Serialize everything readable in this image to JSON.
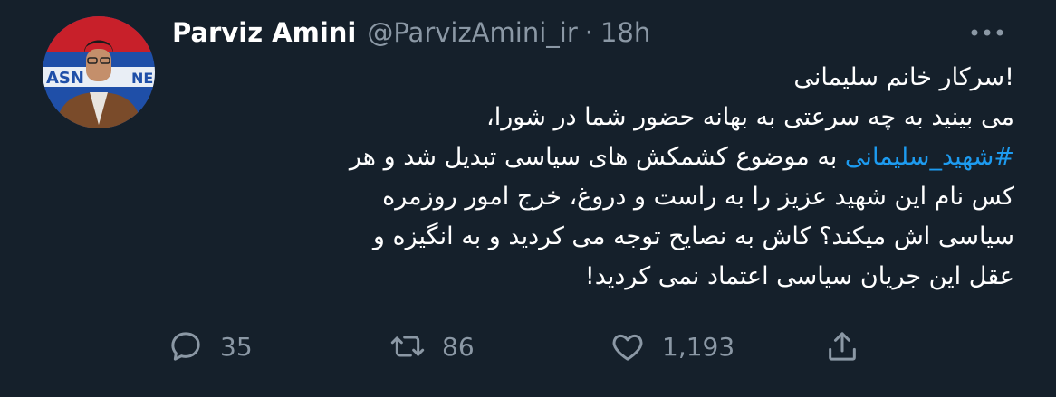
{
  "tweet": {
    "author": {
      "display_name": "Parviz Amini",
      "handle": "@ParvizAmini_ir",
      "separator": "·",
      "time": "18h",
      "avatar_banner_text_1": "ASN",
      "avatar_banner_text_2": "NE"
    },
    "lines": [
      {
        "text": "!سرکار خانم سلیمانی"
      },
      {
        "text": "می بینید به چه سرعتی به بهانه حضور شما در شورا،"
      },
      {
        "hashtag": "#شهید_سلیمانی",
        "text": " به موضوع کشمکش های سیاسی تبدیل شد و هر"
      },
      {
        "text": "کس نام این شهید عزیز را به راست و دروغ، خرج امور روزمره"
      },
      {
        "text": "سیاسی اش  میکند؟ کاش به نصایح توجه می کردید و به انگیزه و"
      },
      {
        "text": "عقل این جریان سیاسی اعتماد نمی کردید!"
      }
    ],
    "actions": {
      "reply": {
        "icon": "reply-icon",
        "count": "35"
      },
      "retweet": {
        "icon": "retweet-icon",
        "count": "86"
      },
      "like": {
        "icon": "heart-icon",
        "count": "1,193"
      },
      "share": {
        "icon": "share-icon"
      }
    },
    "more_icon": "more-icon"
  },
  "colors": {
    "background": "#15202b",
    "text": "#ffffff",
    "secondary": "#8b98a5",
    "link": "#1d9bf0"
  }
}
